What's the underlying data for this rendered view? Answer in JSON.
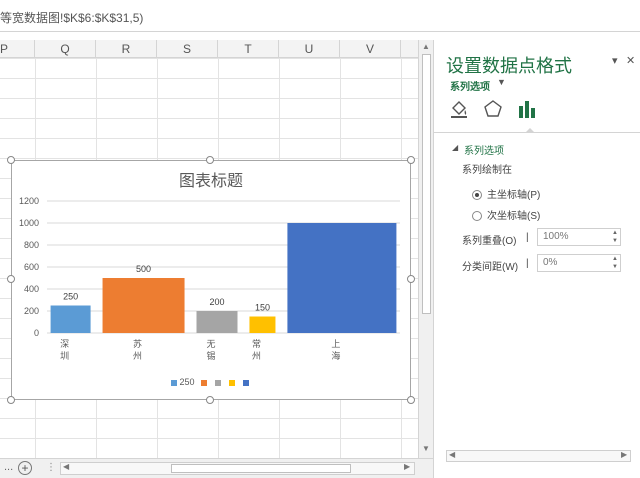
{
  "formula_bar": {
    "text": "等宽数据图!$K$6:$K$31,5)"
  },
  "columns": [
    "P",
    "Q",
    "R",
    "S",
    "T",
    "U",
    "V"
  ],
  "chart_data": {
    "type": "bar",
    "title": "图表标题",
    "categories": [
      "深圳",
      "苏州",
      "无锡",
      "常州",
      "上海"
    ],
    "category_labels": [
      "深\n圳",
      "苏\n州",
      "无\n锡",
      "常\n州",
      "上\n海"
    ],
    "values": [
      250,
      500,
      200,
      150,
      1000
    ],
    "data_labels": [
      "250",
      "500",
      "200",
      "150",
      ""
    ],
    "colors": [
      "#5b9bd5",
      "#ed7d31",
      "#a5a5a5",
      "#ffc000",
      "#4472c4"
    ],
    "widths": [
      40,
      82,
      41,
      26,
      109
    ],
    "ylim": [
      0,
      1200
    ],
    "yticks": [
      "0",
      "200",
      "400",
      "600",
      "800",
      "1000",
      "1200"
    ],
    "grid": true,
    "legend": {
      "position": "bottom",
      "entries": [
        "250",
        "",
        "",
        "",
        ""
      ]
    }
  },
  "pane": {
    "title": "设置数据点格式",
    "close_label": "✕",
    "menu_label": "▾",
    "subtitle": "系列选项",
    "section_title": "系列选项",
    "plot_on_label": "系列绘制在",
    "primary_axis": "主坐标轴(P)",
    "secondary_axis": "次坐标轴(S)",
    "overlap_label": "系列重叠(O)",
    "overlap_value": "100%",
    "gap_label": "分类间距(W)",
    "gap_value": "0%",
    "accent": "#217346"
  },
  "sheetbar": {
    "ellipsis": "...",
    "add": "+"
  }
}
